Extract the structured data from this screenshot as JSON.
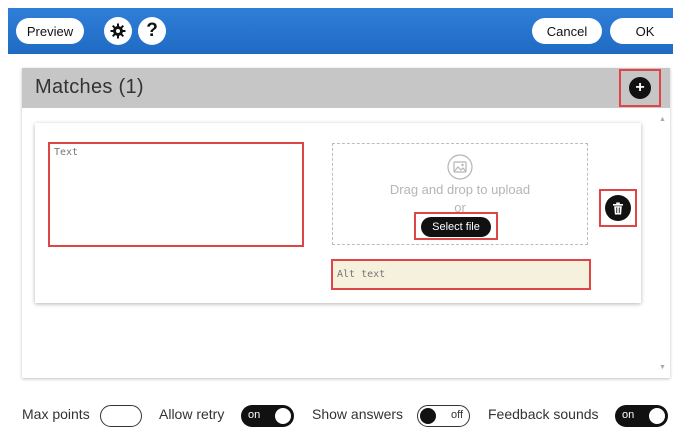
{
  "toolbar": {
    "preview_label": "Preview",
    "settings_icon": "gear-icon",
    "help_label": "?",
    "cancel_label": "Cancel",
    "ok_label": "OK"
  },
  "panel": {
    "title": "Matches (1)",
    "add_label": "+"
  },
  "card": {
    "text_placeholder": "Text",
    "dropzone_text": "Drag and drop to upload",
    "dropzone_or": "or",
    "select_file_label": "Select file",
    "alt_placeholder": "Alt text"
  },
  "footer": {
    "max_points_label": "Max points",
    "allow_retry_label": "Allow retry",
    "allow_retry_state": "on",
    "show_answers_label": "Show answers",
    "show_answers_state": "off",
    "feedback_sounds_label": "Feedback sounds",
    "feedback_sounds_state": "on"
  },
  "colors": {
    "toolbar_blue": "#2f7ed8",
    "highlight_red": "#e04545",
    "header_gray": "#c6c6c6",
    "alt_bg": "#f6f1dd"
  }
}
